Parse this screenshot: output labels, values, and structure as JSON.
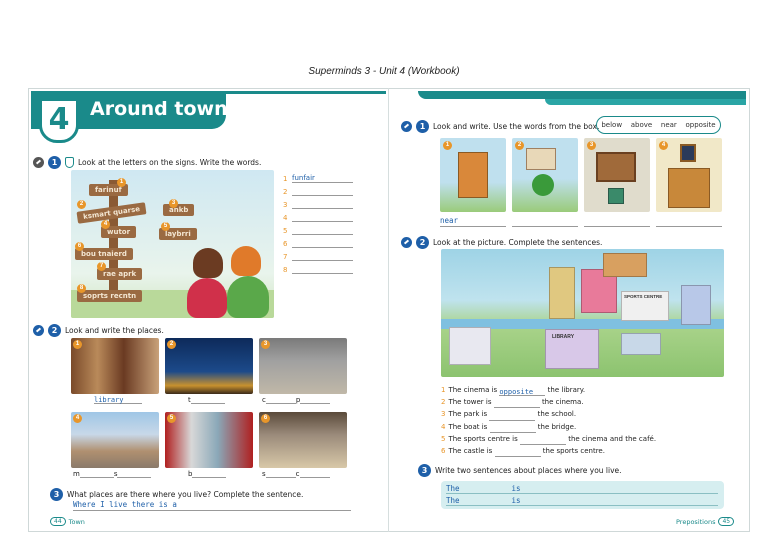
{
  "caption": "Superminds 3 - Unit 4 (Workbook)",
  "unit": {
    "number": "4",
    "title": "Around town"
  },
  "left_page": {
    "ex1": {
      "number": "1",
      "instruction": "Look at the letters on the signs. Write the words.",
      "signs": [
        {
          "n": "1",
          "text": "farinuf"
        },
        {
          "n": "2",
          "text": "ksmart quarse"
        },
        {
          "n": "3",
          "text": "ankb"
        },
        {
          "n": "4",
          "text": "wutor"
        },
        {
          "n": "5",
          "text": "laybrri"
        },
        {
          "n": "6",
          "text": "bou tnaierd"
        },
        {
          "n": "7",
          "text": "rae aprk"
        },
        {
          "n": "8",
          "text": "soprts recntn"
        }
      ],
      "answers": [
        {
          "n": "1",
          "value": "funfair"
        },
        {
          "n": "2",
          "value": ""
        },
        {
          "n": "3",
          "value": ""
        },
        {
          "n": "4",
          "value": ""
        },
        {
          "n": "5",
          "value": ""
        },
        {
          "n": "6",
          "value": ""
        },
        {
          "n": "7",
          "value": ""
        },
        {
          "n": "8",
          "value": ""
        }
      ]
    },
    "ex2": {
      "number": "2",
      "instruction": "Look and write the places.",
      "photos": [
        {
          "n": "1",
          "prefix": "",
          "answer": "library",
          "suffix": ""
        },
        {
          "n": "2",
          "prefix": "t",
          "answer": "",
          "suffix": ""
        },
        {
          "n": "3",
          "prefix": "c",
          "answer": "",
          "suffix": "p"
        },
        {
          "n": "4",
          "prefix": "m",
          "answer": "",
          "suffix": "s"
        },
        {
          "n": "5",
          "prefix": "b",
          "answer": "",
          "suffix": ""
        },
        {
          "n": "6",
          "prefix": "s",
          "answer": "",
          "suffix": "c"
        }
      ]
    },
    "ex3": {
      "number": "3",
      "instruction": "What places are there where you live? Complete the sentence.",
      "answer": "Where I live there is a"
    },
    "footer": {
      "page": "44",
      "label": "Town"
    }
  },
  "right_page": {
    "ex1": {
      "number": "1",
      "instruction": "Look and write. Use the words from the box.",
      "words": [
        "below",
        "above",
        "near",
        "opposite"
      ],
      "pictures": [
        {
          "n": "1",
          "answer": "near"
        },
        {
          "n": "2",
          "answer": ""
        },
        {
          "n": "3",
          "answer": ""
        },
        {
          "n": "4",
          "answer": ""
        }
      ]
    },
    "ex2": {
      "number": "2",
      "instruction": "Look at the picture. Complete the sentences.",
      "picture_labels": {
        "sports": "SPORTS CENTRE",
        "library": "LIBRARY"
      },
      "sentences": [
        {
          "n": "1",
          "before": "The cinema is",
          "answer": "opposite",
          "after": "the library."
        },
        {
          "n": "2",
          "before": "The tower is",
          "answer": "",
          "after": "the cinema."
        },
        {
          "n": "3",
          "before": "The park is",
          "answer": "",
          "after": "the school."
        },
        {
          "n": "4",
          "before": "The boat is",
          "answer": "",
          "after": "the bridge."
        },
        {
          "n": "5",
          "before": "The sports centre is",
          "answer": "",
          "after": "the cinema and the café."
        },
        {
          "n": "6",
          "before": "The castle is",
          "answer": "",
          "after": "the sports centre."
        }
      ]
    },
    "ex3": {
      "number": "3",
      "instruction": "Write two sentences about places where you live.",
      "lines": [
        {
          "start": "The",
          "mid": "is"
        },
        {
          "start": "The",
          "mid": "is"
        }
      ]
    },
    "footer": {
      "label": "Prepositions",
      "page": "45"
    }
  },
  "colors": {
    "teal": "#1a8a8a",
    "blue": "#1e5fa8",
    "orange": "#e8962a"
  }
}
